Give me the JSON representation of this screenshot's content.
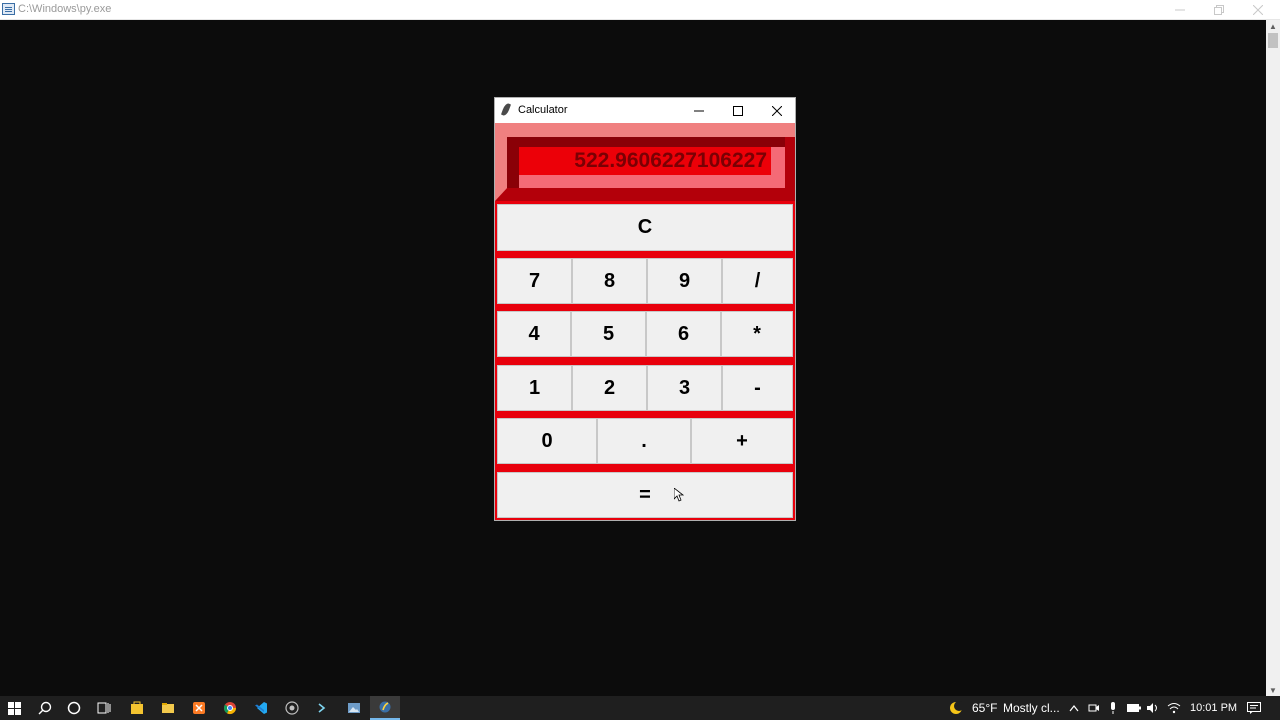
{
  "console": {
    "title": "C:\\Windows\\py.exe"
  },
  "calculator": {
    "title": "Calculator",
    "display_value": "522.9606227106227",
    "buttons": {
      "clear": "C",
      "seven": "7",
      "eight": "8",
      "nine": "9",
      "divide": "/",
      "four": "4",
      "five": "5",
      "six": "6",
      "multiply": "*",
      "one": "1",
      "two": "2",
      "three": "3",
      "subtract": "-",
      "zero": "0",
      "dot": ".",
      "add": "+",
      "equals": "="
    },
    "colors": {
      "frame": "#e8000c",
      "display_text": "#7a0004",
      "button_bg": "#f0f0f0"
    }
  },
  "taskbar": {
    "weather_temp": "65°F",
    "weather_text": "Mostly cl...",
    "clock": "10:01 PM"
  }
}
